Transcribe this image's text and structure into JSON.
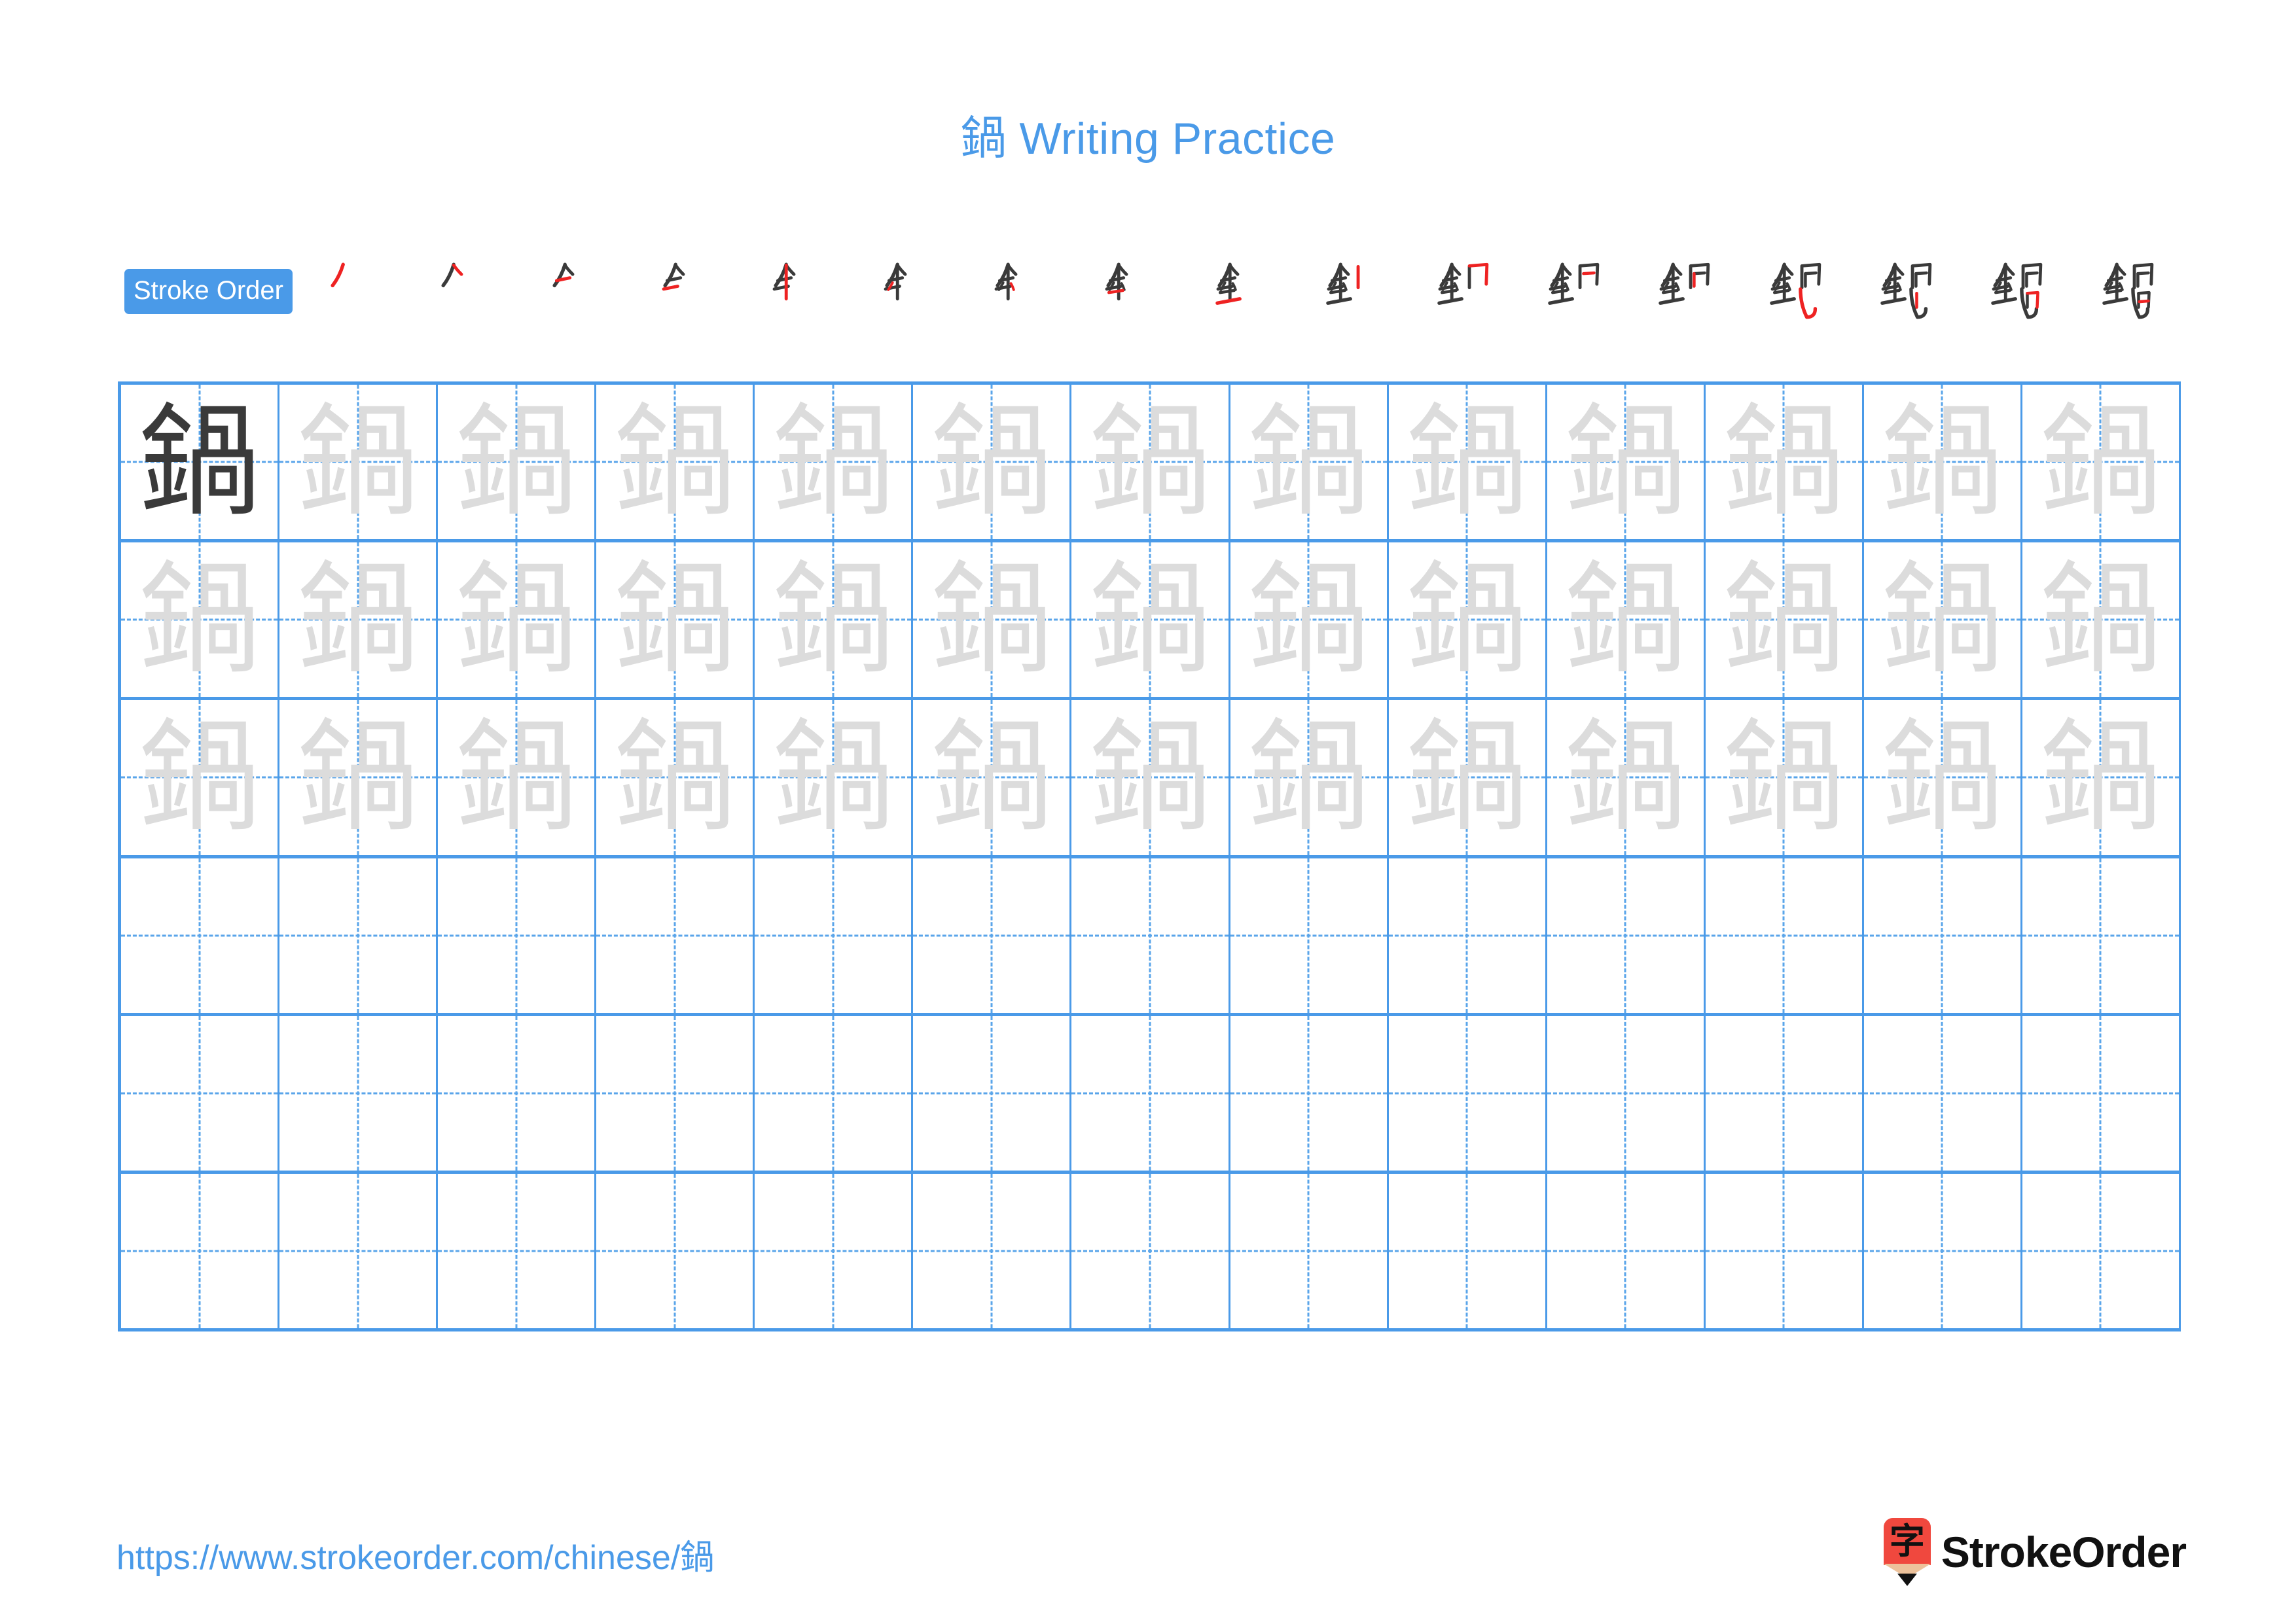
{
  "page": {
    "character": "鍋",
    "title": "鍋 Writing Practice",
    "title_char": "鍋",
    "title_text": " Writing Practice",
    "accent_color": "#4a9ae8",
    "ink_color": "#3a3a3a",
    "trace_color": "#dcdcdc",
    "highlight_color": "#ee2222"
  },
  "stroke_order": {
    "badge_label": "Stroke Order",
    "total_strokes": 17,
    "steps": [
      {
        "index": 1,
        "char": "鍋",
        "new_stroke": "丿"
      },
      {
        "index": 2,
        "char": "鍋",
        "new_stroke": "丶"
      },
      {
        "index": 3,
        "char": "鍋",
        "new_stroke": "一"
      },
      {
        "index": 4,
        "char": "鍋",
        "new_stroke": "一"
      },
      {
        "index": 5,
        "char": "鍋",
        "new_stroke": "丨"
      },
      {
        "index": 6,
        "char": "鍋",
        "new_stroke": "丶"
      },
      {
        "index": 7,
        "char": "鍋",
        "new_stroke": "丶"
      },
      {
        "index": 8,
        "char": "鍋",
        "new_stroke": "一"
      },
      {
        "index": 9,
        "char": "鍋",
        "new_stroke": "丨"
      },
      {
        "index": 10,
        "char": "鍋",
        "new_stroke": "𠃍"
      },
      {
        "index": 11,
        "char": "鍋",
        "new_stroke": "丨"
      },
      {
        "index": 12,
        "char": "鍋",
        "new_stroke": "𠃍"
      },
      {
        "index": 13,
        "char": "鍋",
        "new_stroke": "丨"
      },
      {
        "index": 14,
        "char": "鍋",
        "new_stroke": "㇉"
      },
      {
        "index": 15,
        "char": "鍋",
        "new_stroke": "丨"
      },
      {
        "index": 16,
        "char": "鍋",
        "new_stroke": "𠃍"
      },
      {
        "index": 17,
        "char": "鍋",
        "new_stroke": "一"
      }
    ]
  },
  "practice_grid": {
    "columns": 13,
    "rows": 6,
    "cell_character": "鍋",
    "rows_data": [
      {
        "row": 1,
        "cells": [
          "鍋",
          "鍋",
          "鍋",
          "鍋",
          "鍋",
          "鍋",
          "鍋",
          "鍋",
          "鍋",
          "鍋",
          "鍋",
          "鍋",
          "鍋"
        ],
        "first_cell_dark": true
      },
      {
        "row": 2,
        "cells": [
          "鍋",
          "鍋",
          "鍋",
          "鍋",
          "鍋",
          "鍋",
          "鍋",
          "鍋",
          "鍋",
          "鍋",
          "鍋",
          "鍋",
          "鍋"
        ],
        "first_cell_dark": false
      },
      {
        "row": 3,
        "cells": [
          "鍋",
          "鍋",
          "鍋",
          "鍋",
          "鍋",
          "鍋",
          "鍋",
          "鍋",
          "鍋",
          "鍋",
          "鍋",
          "鍋",
          "鍋"
        ],
        "first_cell_dark": false
      },
      {
        "row": 4,
        "cells": [
          "",
          "",
          "",
          "",
          "",
          "",
          "",
          "",
          "",
          "",
          "",
          "",
          ""
        ],
        "first_cell_dark": false
      },
      {
        "row": 5,
        "cells": [
          "",
          "",
          "",
          "",
          "",
          "",
          "",
          "",
          "",
          "",
          "",
          "",
          ""
        ],
        "first_cell_dark": false
      },
      {
        "row": 6,
        "cells": [
          "",
          "",
          "",
          "",
          "",
          "",
          "",
          "",
          "",
          "",
          "",
          "",
          ""
        ],
        "first_cell_dark": false
      }
    ]
  },
  "footer": {
    "url": "https://www.strokeorder.com/chinese/鍋",
    "url_prefix": "https://www.strokeorder.com/chinese/",
    "url_char": "鍋",
    "brand_name": "StrokeOrder",
    "brand_glyph": "字",
    "brand_red": "#f0483e",
    "brand_wood": "#edc29b"
  }
}
